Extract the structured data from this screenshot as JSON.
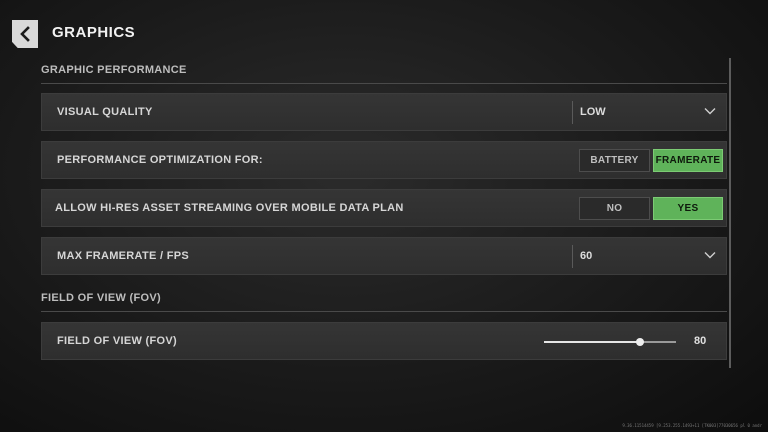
{
  "header": {
    "title": "GRAPHICS"
  },
  "sections": {
    "performance": "GRAPHIC PERFORMANCE",
    "fov": "FIELD OF VIEW (FOV)"
  },
  "settings": {
    "visual_quality": {
      "label": "VISUAL QUALITY",
      "value": "LOW"
    },
    "optimization": {
      "label": "PERFORMANCE OPTIMIZATION FOR:",
      "options": [
        "BATTERY",
        "FRAMERATE"
      ],
      "selected": "FRAMERATE"
    },
    "hires_streaming": {
      "label": "ALLOW HI-RES ASSET STREAMING OVER MOBILE DATA PLAN",
      "options": [
        "NO",
        "YES"
      ],
      "selected": "YES"
    },
    "max_framerate": {
      "label": "MAX FRAMERATE / FPS",
      "value": "60"
    },
    "fov": {
      "label": "FIELD OF VIEW (FOV)",
      "value": "80",
      "fraction": 0.73
    }
  },
  "footer": {
    "build_info": "9.36.11514459 [9.253.255.1493+11 [TK003]77030656 pl 0 andr"
  },
  "colors": {
    "accent_green": "#5fb35a",
    "panel": "#323232",
    "background": "#121212"
  },
  "icons": {
    "back": "chevron-left-icon",
    "dropdown": "chevron-down-icon"
  }
}
